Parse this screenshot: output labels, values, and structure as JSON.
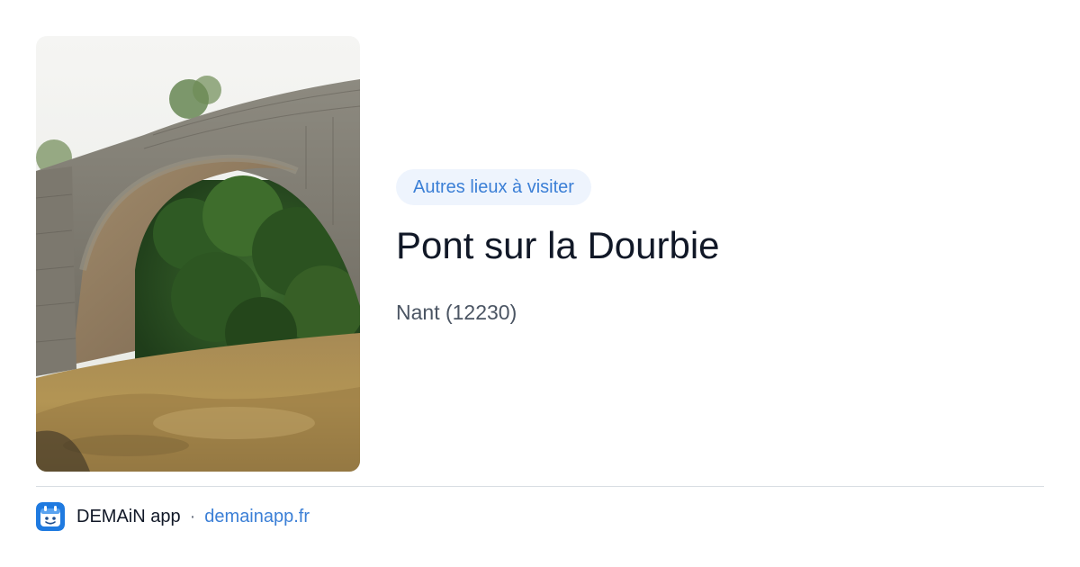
{
  "place": {
    "category_badge": "Autres lieux à visiter",
    "name": "Pont sur la Dourbie",
    "location": "Nant (12230)",
    "photo_icon": "stone-arch-bridge-photo"
  },
  "footer": {
    "app_name": "DEMAiN app",
    "separator": "·",
    "domain": "demainapp.fr",
    "app_icon": "demain-app-logo-icon"
  },
  "colors": {
    "accent": "#3b7fd6",
    "badge_background": "#eef4fd",
    "title": "#111827",
    "subtitle": "#4b5563",
    "divider": "#d9dee3",
    "app_icon_background": "#1f7ae0"
  }
}
